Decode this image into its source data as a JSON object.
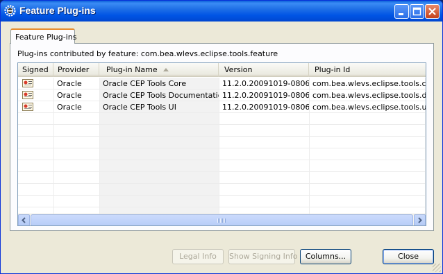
{
  "window": {
    "title": "Feature Plug-ins",
    "icon": "eclipse-gear-icon"
  },
  "tab": {
    "label": "Feature Plug-ins"
  },
  "panel": {
    "description": "Plug-ins contributed by feature: com.bea.wlevs.eclipse.tools.feature"
  },
  "table": {
    "columns": [
      "Signed",
      "Provider",
      "Plug-in Name",
      "Version",
      "Plug-in Id"
    ],
    "sorted_column": "Plug-in Name",
    "rows": [
      {
        "signed_icon": "certificate-icon",
        "provider": "Oracle",
        "name": "Oracle CEP Tools Core",
        "version": "11.2.0.20091019-0806",
        "id": "com.bea.wlevs.eclipse.tools.core"
      },
      {
        "signed_icon": "certificate-icon",
        "provider": "Oracle",
        "name": "Oracle CEP Tools Documentation",
        "version": "11.2.0.20091019-0806",
        "id": "com.bea.wlevs.eclipse.tools.doc"
      },
      {
        "signed_icon": "certificate-icon",
        "provider": "Oracle",
        "name": "Oracle CEP Tools UI",
        "version": "11.2.0.20091019-0806",
        "id": "com.bea.wlevs.eclipse.tools.ui"
      }
    ]
  },
  "buttons": {
    "legal_info": "Legal Info",
    "signing_info": "Show Signing Info",
    "columns": "Columns...",
    "close": "Close"
  },
  "colors": {
    "titlebar": "#0054e3",
    "tab_accent": "#e68b2c",
    "window_bg": "#ece9d8"
  }
}
